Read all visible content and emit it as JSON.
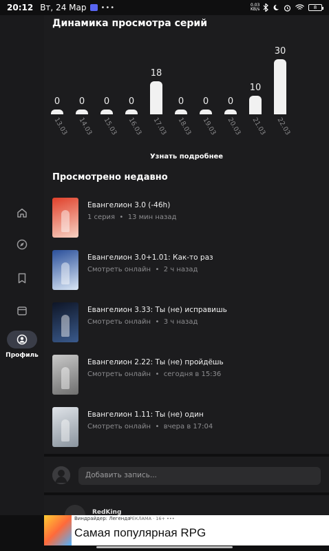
{
  "status_bar": {
    "time": "20:12",
    "date": "Вт, 24 Мар",
    "speed_value": "0.03",
    "speed_unit": "KB/s",
    "battery": "8"
  },
  "rail": {
    "items": [
      {
        "icon": "home-icon",
        "label": ""
      },
      {
        "icon": "compass-icon",
        "label": ""
      },
      {
        "icon": "bookmark-icon",
        "label": ""
      },
      {
        "icon": "calendar-icon",
        "label": ""
      },
      {
        "icon": "profile-icon",
        "label": "Профиль",
        "active": true
      }
    ]
  },
  "chart": {
    "title": "Динамика просмотра серий",
    "more_label": "Узнать подробнее",
    "accent": "#f1f1f1"
  },
  "chart_data": {
    "type": "bar",
    "categories": [
      "13.03",
      "14.03",
      "15.03",
      "16.03",
      "17.03",
      "18.03",
      "19.03",
      "20.03",
      "21.03",
      "22.03"
    ],
    "values": [
      0,
      0,
      0,
      0,
      18,
      0,
      0,
      0,
      10,
      30
    ],
    "title": "",
    "xlabel": "",
    "ylabel": "",
    "ylim": [
      0,
      30
    ],
    "grid": false
  },
  "recent": {
    "title": "Просмотрено недавно",
    "items": [
      {
        "title": "Евангелион 3.0 (-46h)",
        "meta": "1 серия",
        "time": "13 мин назад",
        "poster_colors": [
          "#e0402a",
          "#f7d2c4"
        ]
      },
      {
        "title": "Евангелион 3.0+1.01: Как-то раз",
        "meta": "Смотреть онлайн",
        "time": "2 ч назад",
        "poster_colors": [
          "#2a4f9a",
          "#d9e6f5"
        ]
      },
      {
        "title": "Евангелион 3.33: Ты (не) исправишь",
        "meta": "Смотреть онлайн",
        "time": "3 ч назад",
        "poster_colors": [
          "#0e1526",
          "#3a5a8c"
        ]
      },
      {
        "title": "Евангелион 2.22: Ты (не) пройдёшь",
        "meta": "Смотреть онлайн",
        "time": "сегодня в 15:36",
        "poster_colors": [
          "#c9c9c9",
          "#6f6f6f"
        ]
      },
      {
        "title": "Евангелион 1.11: Ты (не) один",
        "meta": "Смотреть онлайн",
        "time": "вчера в 17:04",
        "poster_colors": [
          "#dfe3e8",
          "#8a949e"
        ]
      }
    ]
  },
  "comment": {
    "placeholder": "Добавить запись..."
  },
  "post": {
    "author": "RedKing"
  },
  "ad": {
    "app_name": "Виндрайдер: Легенда",
    "tag": "РЕКЛАМА · 16+",
    "headline": "Самая популярная RPG"
  }
}
